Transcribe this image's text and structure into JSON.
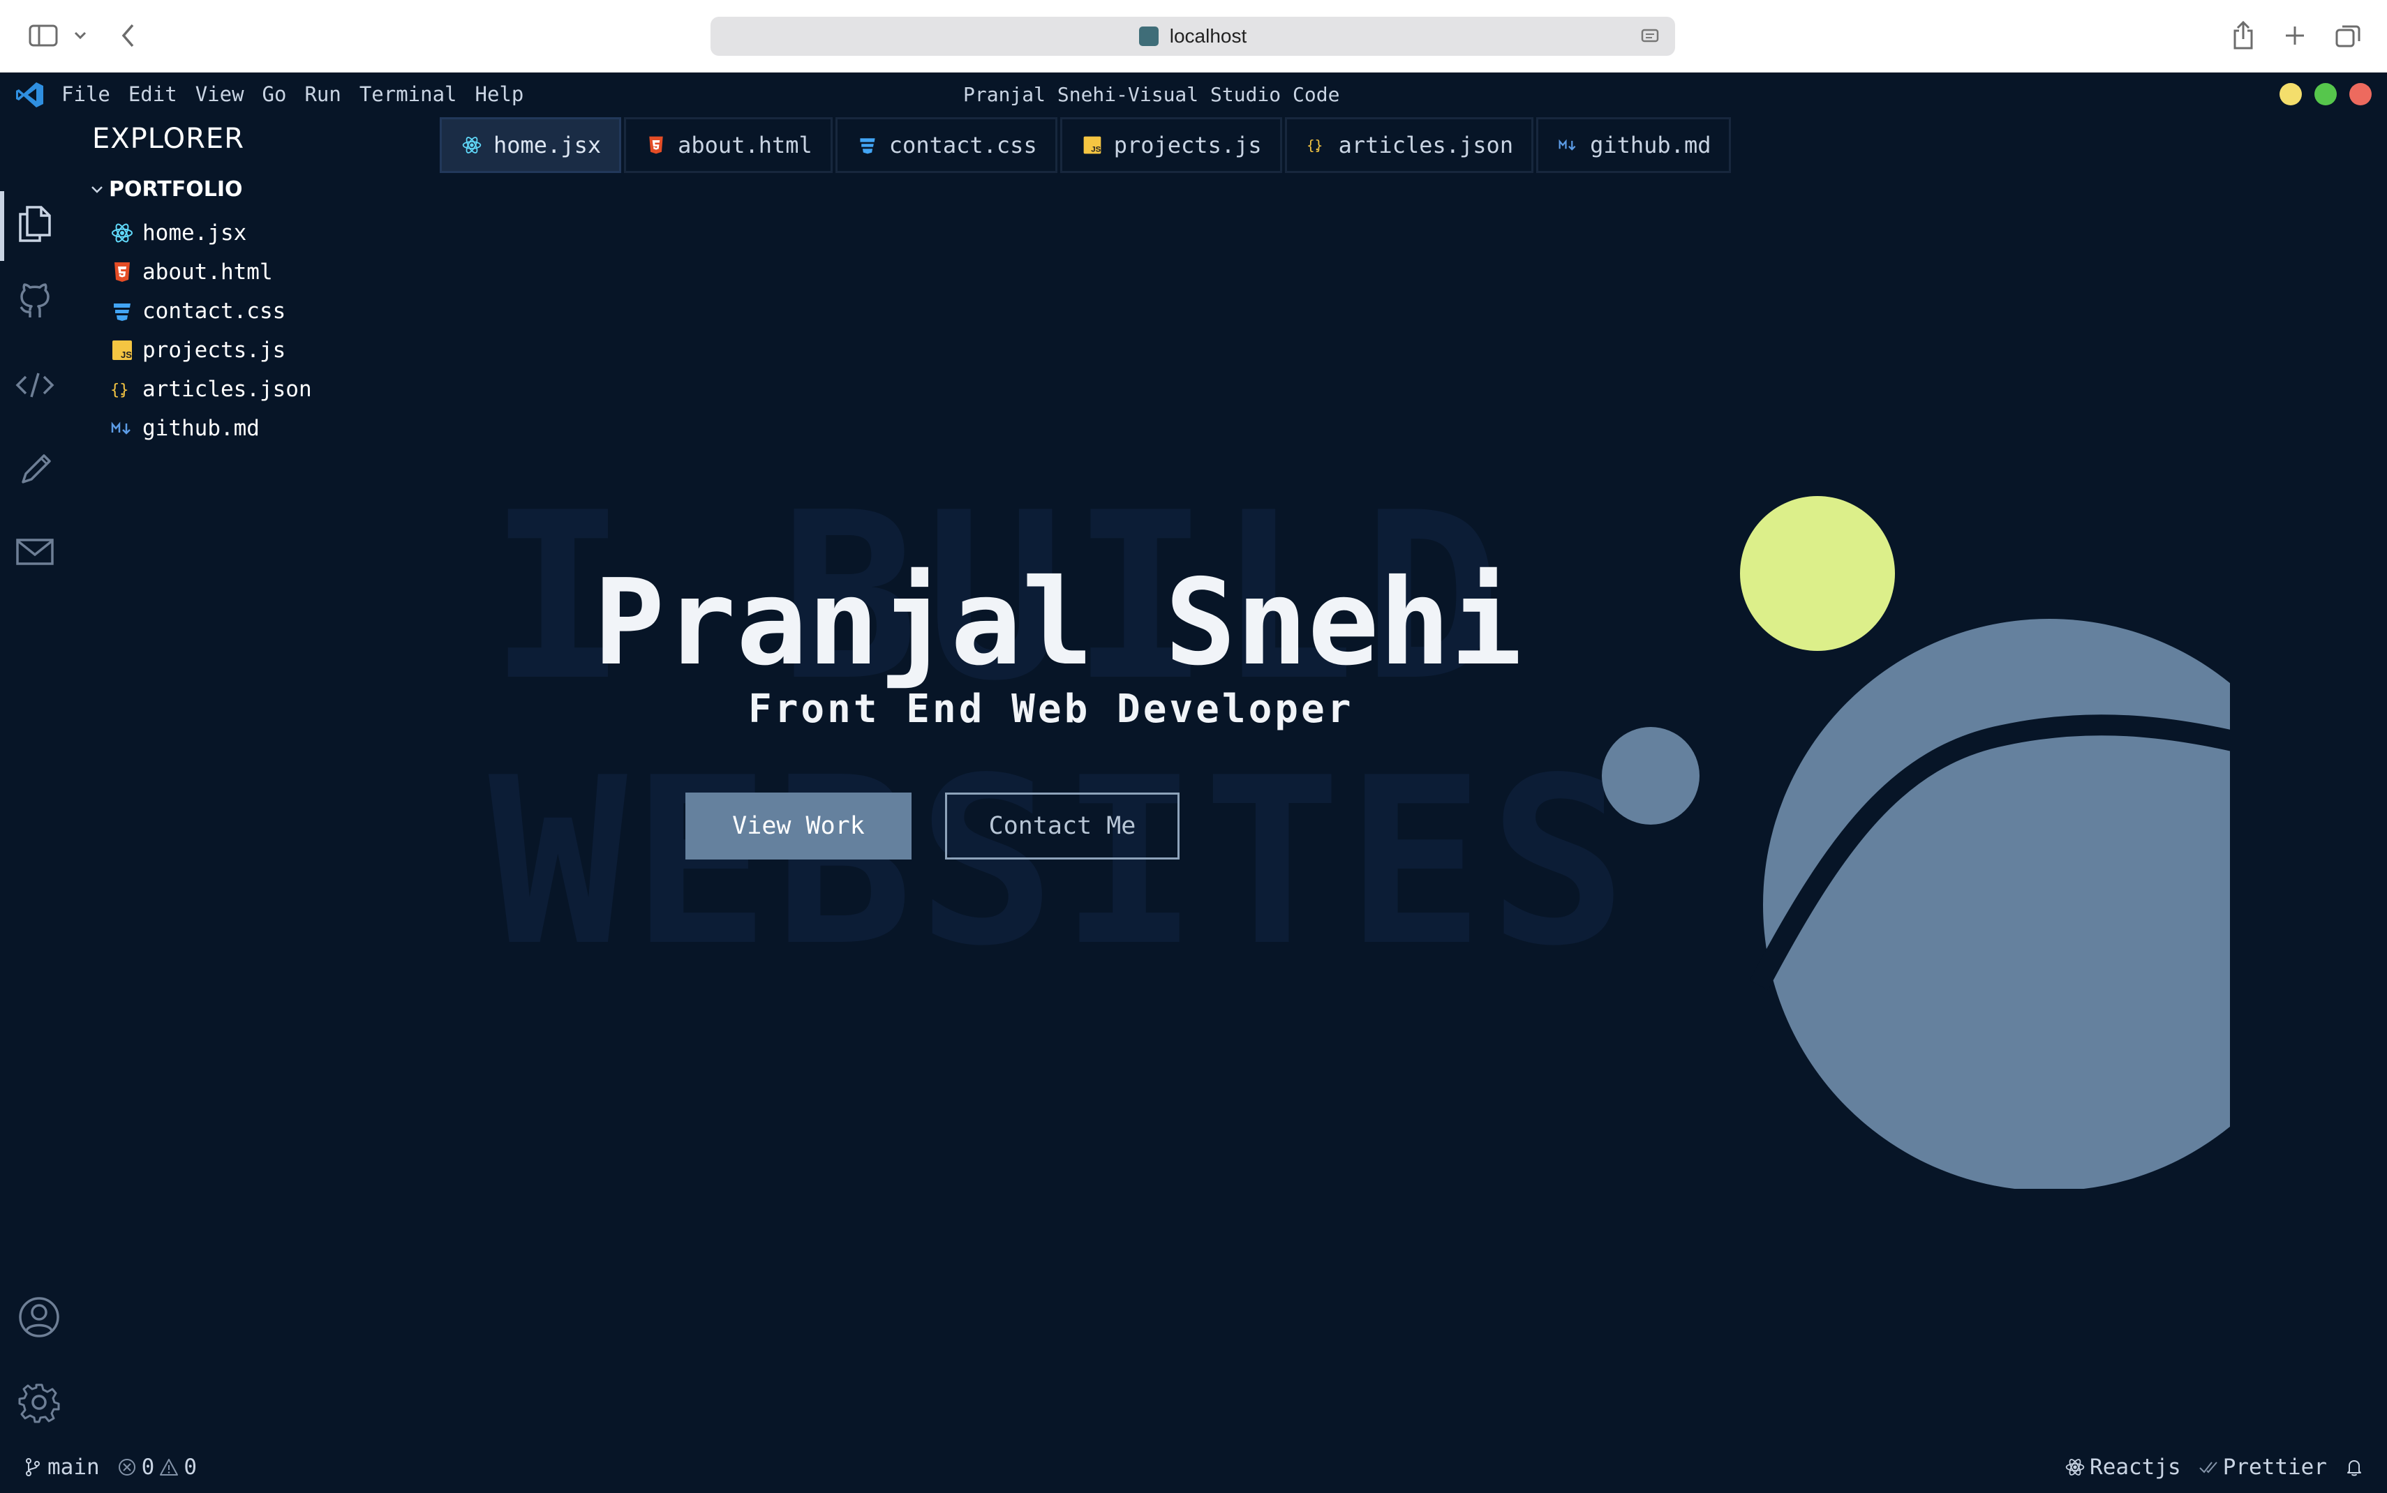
{
  "browser": {
    "url": "localhost"
  },
  "window": {
    "title": "Pranjal Snehi-Visual Studio Code",
    "menu": [
      "File",
      "Edit",
      "View",
      "Go",
      "Run",
      "Terminal",
      "Help"
    ]
  },
  "explorer": {
    "title": "EXPLORER",
    "folder": "PORTFOLIO",
    "files": [
      {
        "name": "home.jsx",
        "icon": "react-icon"
      },
      {
        "name": "about.html",
        "icon": "html-icon"
      },
      {
        "name": "contact.css",
        "icon": "css-icon"
      },
      {
        "name": "projects.js",
        "icon": "js-icon"
      },
      {
        "name": "articles.json",
        "icon": "json-icon"
      },
      {
        "name": "github.md",
        "icon": "markdown-icon"
      }
    ]
  },
  "tabs": [
    {
      "label": "home.jsx",
      "active": true
    },
    {
      "label": "about.html"
    },
    {
      "label": "contact.css"
    },
    {
      "label": "projects.js"
    },
    {
      "label": "articles.json"
    },
    {
      "label": "github.md"
    }
  ],
  "hero": {
    "bg_line1": "I BUILD",
    "bg_line2": "WEBSITES",
    "name": "Pranjal Snehi",
    "role": "Front End Web Developer",
    "primary_button": "View Work",
    "secondary_button": "Contact Me"
  },
  "status": {
    "branch": "main",
    "errors": "0",
    "warnings": "0",
    "framework": "Reactjs",
    "formatter": "Prettier"
  },
  "colors": {
    "background": "#071527",
    "accent_yellow": "#dcef8a",
    "accent_slate": "#65819e",
    "text": "#f1f4f8",
    "traffic_yellow": "#f4de6c",
    "traffic_green": "#56c64c",
    "traffic_red": "#ed6a5e"
  }
}
